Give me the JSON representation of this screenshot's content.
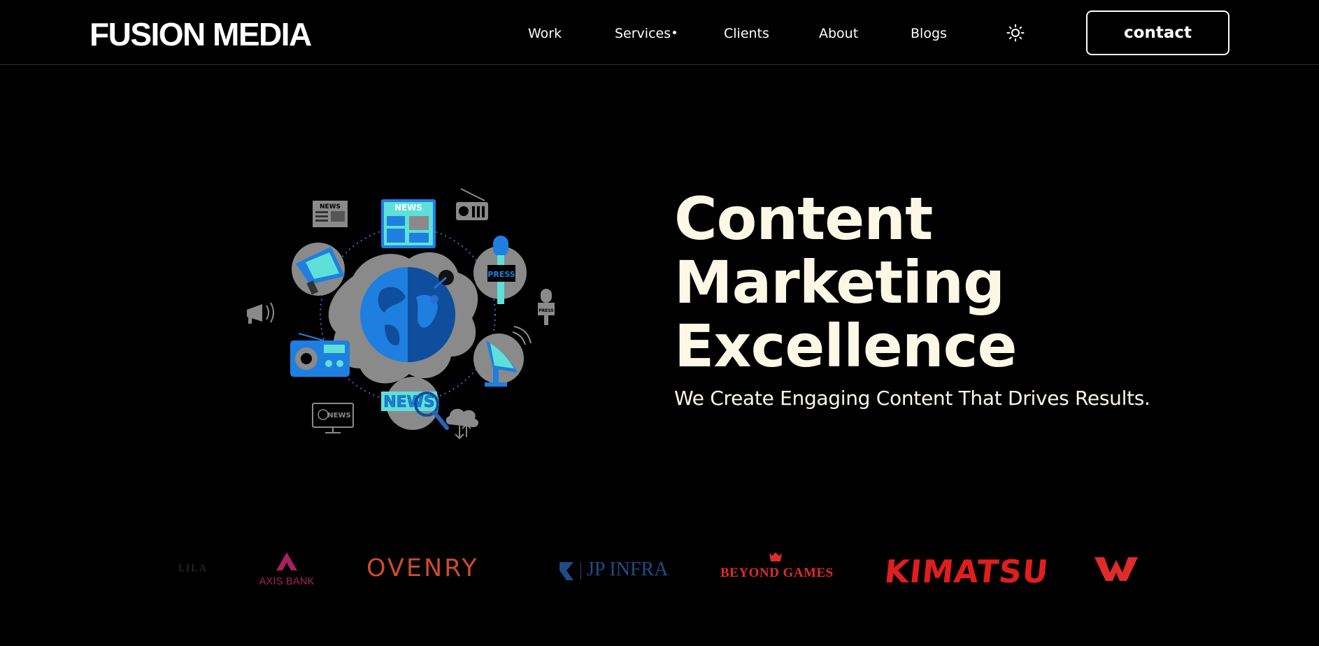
{
  "header": {
    "logo": "FUSION MEDIA",
    "nav": [
      {
        "label": "Work"
      },
      {
        "label": "Services"
      },
      {
        "label": "Clients"
      },
      {
        "label": "About"
      },
      {
        "label": "Blogs"
      }
    ],
    "theme_icon": "sun-icon",
    "contact_label": "contact"
  },
  "hero": {
    "title_lines": [
      "Content",
      "Marketing",
      "Excellence"
    ],
    "subtitle": "We Create Engaging Content That Drives Results.",
    "illustration_labels": {
      "news_top": "NEWS",
      "news_small": "NEWS",
      "press_main": "PRESS",
      "press_small": "PRESS",
      "news_bottom": "NEWS",
      "news_tv": "NEWS"
    }
  },
  "clients": {
    "faded": "LILA",
    "axis": "AXIS BANK",
    "ovenry": "OVENRY",
    "jp_infra": "JP INFRA",
    "beyond_games": "BEYOND GAMES",
    "kimatsu": "KIMATSU"
  },
  "colors": {
    "background": "#000000",
    "hero_text": "#fdf8e6",
    "accent_blue": "#1e7fe0",
    "accent_teal": "#5ee0d8",
    "kimatsu_red": "#e01e1e"
  }
}
